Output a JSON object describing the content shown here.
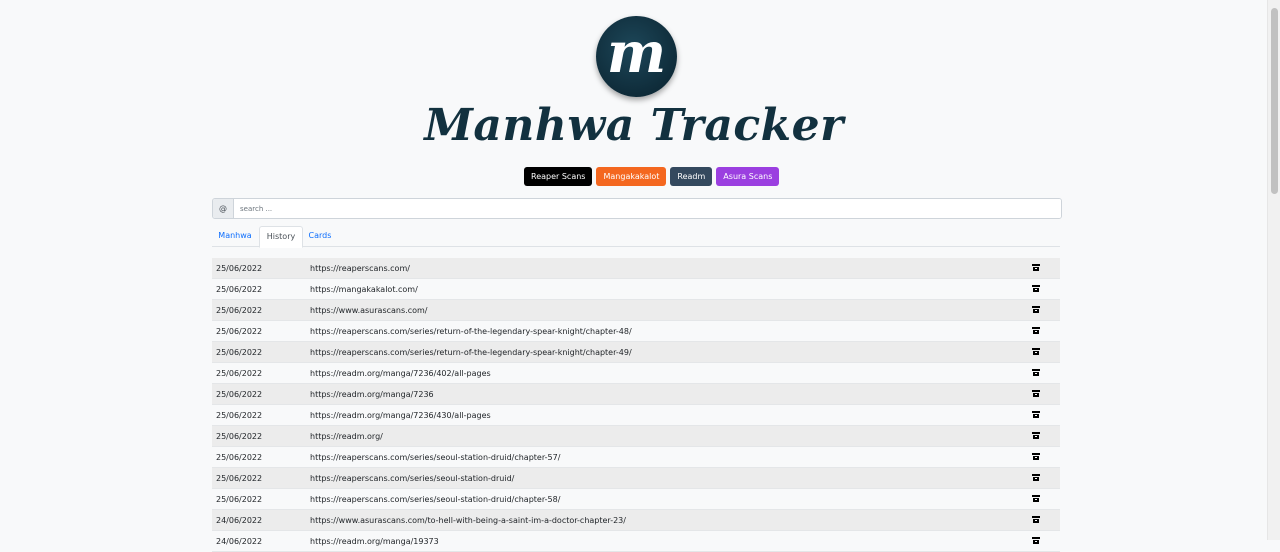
{
  "app": {
    "logo_letter": "m",
    "title": "Manhwa Tracker"
  },
  "sources": [
    {
      "label": "Reaper Scans",
      "color": "#000000"
    },
    {
      "label": "Mangakakalot",
      "color": "#f4671f"
    },
    {
      "label": "Readm",
      "color": "#34495e"
    },
    {
      "label": "Asura Scans",
      "color": "#9b3fe0"
    }
  ],
  "search": {
    "addon": "@",
    "placeholder": "search ..."
  },
  "tabs": [
    {
      "label": "Manhwa",
      "active": false
    },
    {
      "label": "History",
      "active": true
    },
    {
      "label": "Cards",
      "active": false
    }
  ],
  "history": [
    {
      "date": "25/06/2022",
      "url": "https://reaperscans.com/"
    },
    {
      "date": "25/06/2022",
      "url": "https://mangakakalot.com/"
    },
    {
      "date": "25/06/2022",
      "url": "https://www.asurascans.com/"
    },
    {
      "date": "25/06/2022",
      "url": "https://reaperscans.com/series/return-of-the-legendary-spear-knight/chapter-48/"
    },
    {
      "date": "25/06/2022",
      "url": "https://reaperscans.com/series/return-of-the-legendary-spear-knight/chapter-49/"
    },
    {
      "date": "25/06/2022",
      "url": "https://readm.org/manga/7236/402/all-pages"
    },
    {
      "date": "25/06/2022",
      "url": "https://readm.org/manga/7236"
    },
    {
      "date": "25/06/2022",
      "url": "https://readm.org/manga/7236/430/all-pages"
    },
    {
      "date": "25/06/2022",
      "url": "https://readm.org/"
    },
    {
      "date": "25/06/2022",
      "url": "https://reaperscans.com/series/seoul-station-druid/chapter-57/"
    },
    {
      "date": "25/06/2022",
      "url": "https://reaperscans.com/series/seoul-station-druid/"
    },
    {
      "date": "25/06/2022",
      "url": "https://reaperscans.com/series/seoul-station-druid/chapter-58/"
    },
    {
      "date": "24/06/2022",
      "url": "https://www.asurascans.com/to-hell-with-being-a-saint-im-a-doctor-chapter-23/"
    },
    {
      "date": "24/06/2022",
      "url": "https://readm.org/manga/19373"
    }
  ],
  "row_action_icon": "archive-icon"
}
